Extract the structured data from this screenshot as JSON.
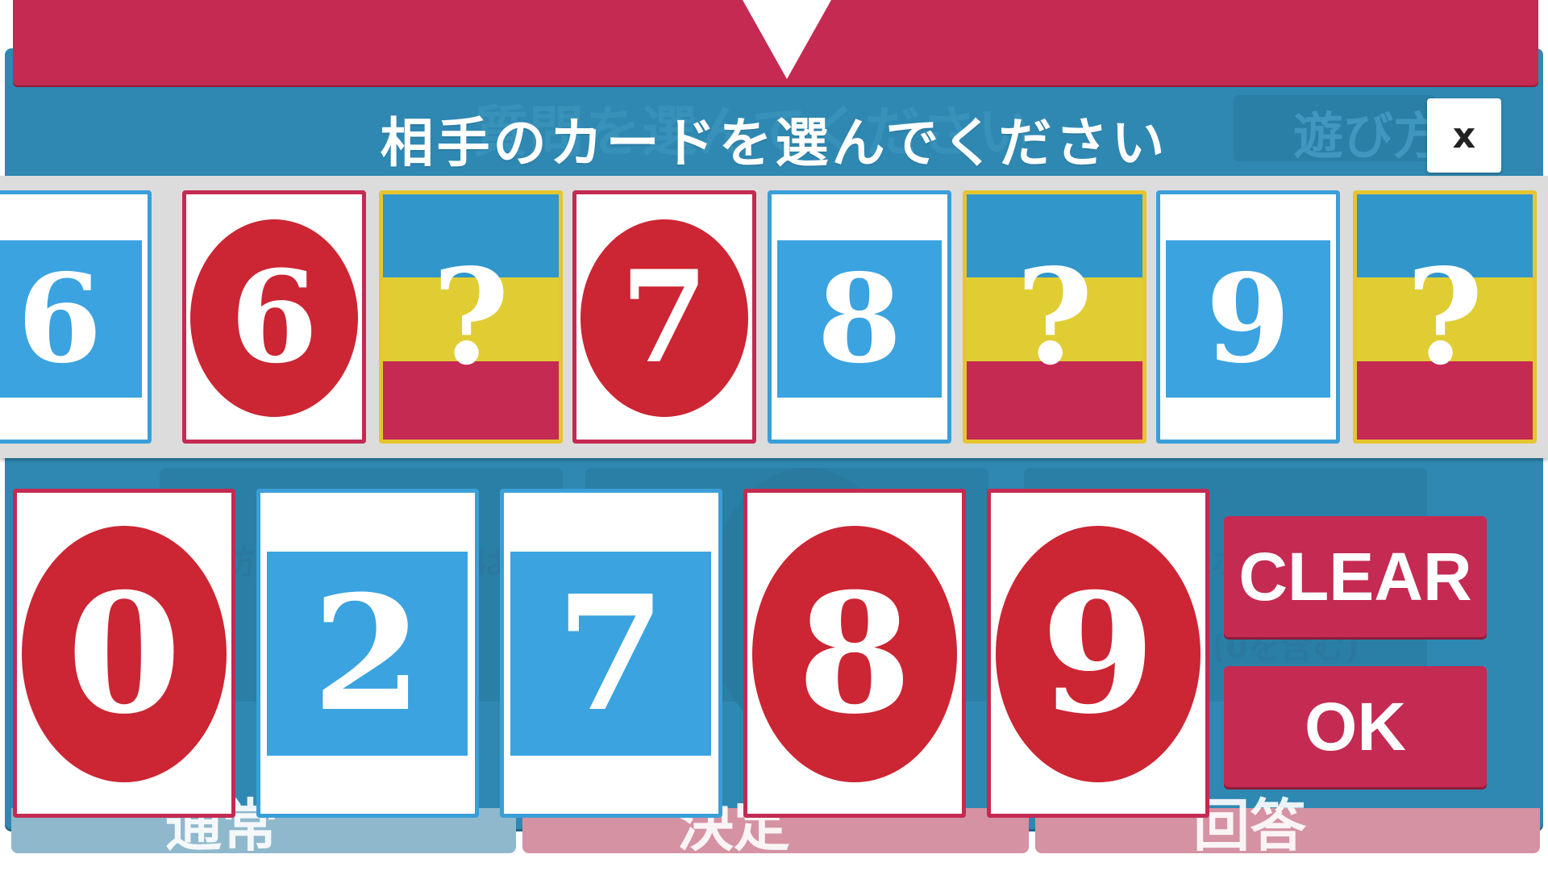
{
  "instruction": "相手のカードを選んでください",
  "close_button": {
    "label": "x"
  },
  "background": {
    "title": "質問を選んでください",
    "top_button": "遊び方",
    "side_text_left": "防",
    "side_text_mid": "は",
    "side_text_right": "ホ",
    "side_text_right2": "(0を含む)",
    "footer_left": "通常",
    "footer_mid": "決定",
    "footer_right": "回答"
  },
  "opponent_cards": [
    {
      "type": "number",
      "color": "blue",
      "value": "6"
    },
    {
      "type": "number",
      "color": "red",
      "value": "6"
    },
    {
      "type": "hidden",
      "value": "?"
    },
    {
      "type": "number",
      "color": "red",
      "value": "7"
    },
    {
      "type": "number",
      "color": "blue",
      "value": "8"
    },
    {
      "type": "hidden",
      "value": "?"
    },
    {
      "type": "number",
      "color": "blue",
      "value": "9"
    },
    {
      "type": "hidden",
      "value": "?"
    }
  ],
  "my_cards": [
    {
      "color": "red",
      "value": "0"
    },
    {
      "color": "blue",
      "value": "2"
    },
    {
      "color": "blue",
      "value": "7"
    },
    {
      "color": "red",
      "value": "8"
    },
    {
      "color": "red",
      "value": "9"
    }
  ],
  "buttons": {
    "clear": "CLEAR",
    "ok": "OK"
  },
  "colors": {
    "primary_red": "#c42a52",
    "card_red": "#cc2533",
    "card_blue": "#3aa3e0",
    "modal_blue": "#2f88b2",
    "hidden_yellow": "#e0cd33"
  }
}
